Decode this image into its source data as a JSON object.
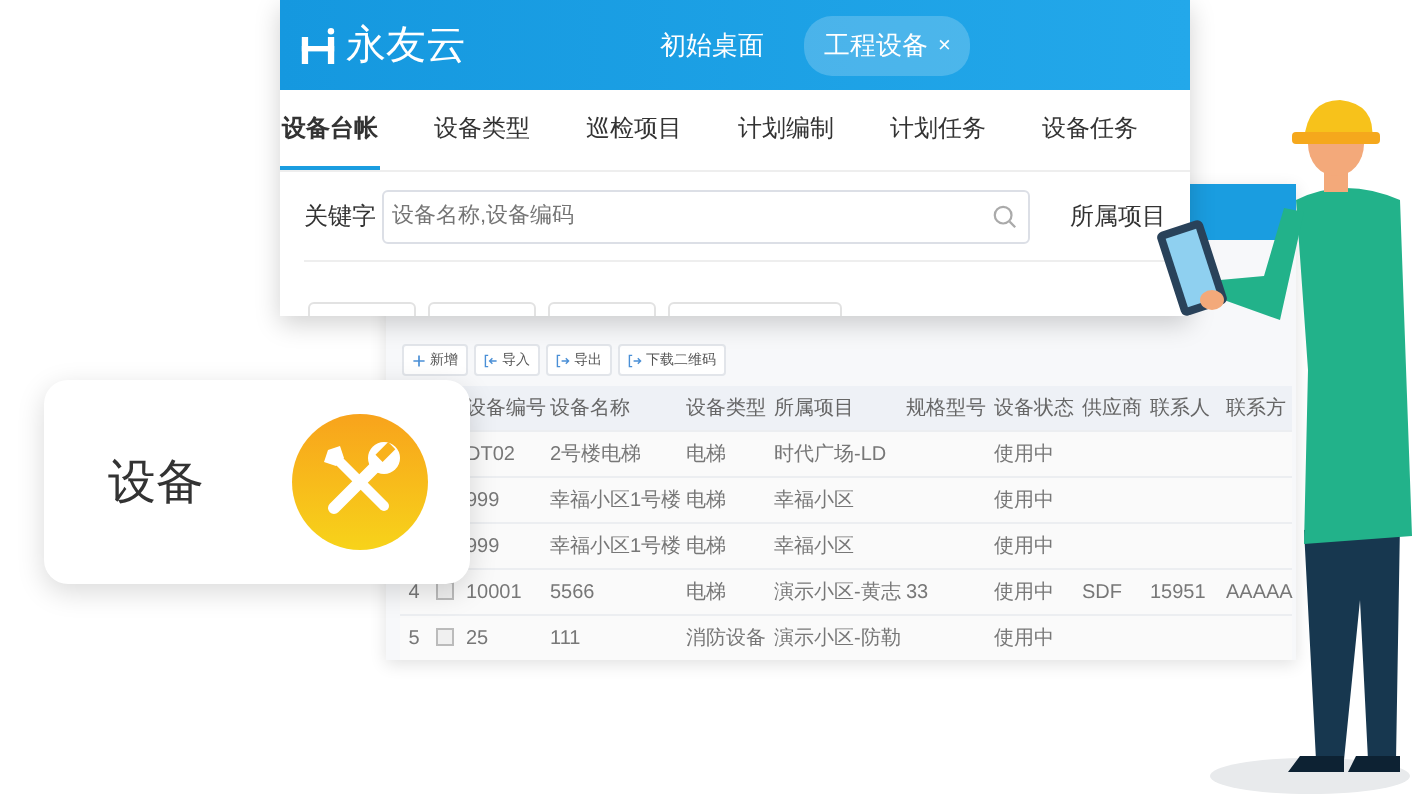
{
  "app_window": {
    "logo": "永友云",
    "open_tabs": [
      {
        "label": "初始桌面",
        "selected": false
      },
      {
        "label": "工程设备",
        "selected": true,
        "close": "×"
      }
    ],
    "nav_tabs": [
      {
        "label": "设备台帐",
        "selected": true
      },
      {
        "label": "设备类型",
        "selected": false
      },
      {
        "label": "巡检项目",
        "selected": false
      },
      {
        "label": "计划编制",
        "selected": false
      },
      {
        "label": "计划任务",
        "selected": false
      },
      {
        "label": "设备任务",
        "selected": false
      }
    ],
    "search": {
      "label": "关键字",
      "placeholder": "设备名称,设备编码",
      "project_label": "所属项目"
    }
  },
  "ledger": {
    "toolbar": [
      {
        "kind": "add",
        "label": "新增"
      },
      {
        "kind": "import",
        "label": "导入"
      },
      {
        "kind": "export",
        "label": "导出"
      },
      {
        "kind": "export",
        "label": "下载二维码"
      }
    ],
    "columns": [
      "设备编号",
      "设备名称",
      "设备类型",
      "所属项目",
      "规格型号",
      "设备状态",
      "供应商",
      "联系人",
      "联系方"
    ],
    "rows": [
      {
        "cells": [
          "DT02",
          "2号楼电梯",
          "电梯",
          "时代广场-LD",
          "",
          "使用中",
          "",
          "",
          ""
        ]
      },
      {
        "cells": [
          "999",
          "幸福小区1号楼",
          "电梯",
          "幸福小区",
          "",
          "使用中",
          "",
          "",
          ""
        ]
      },
      {
        "cells": [
          "999",
          "幸福小区1号楼",
          "电梯",
          "幸福小区",
          "",
          "使用中",
          "",
          "",
          ""
        ]
      },
      {
        "number": "4",
        "checked": false,
        "cells": [
          "10001",
          "5566",
          "电梯",
          "演示小区-黄志",
          "33",
          "使用中",
          "SDF",
          "15951",
          "AAAAA"
        ]
      },
      {
        "number": "5",
        "checked": false,
        "cells": [
          "25",
          "111",
          "消防设备",
          "演示小区-防勒",
          "",
          "使用中",
          "",
          "",
          ""
        ]
      }
    ]
  },
  "feature_card": {
    "label": "设备"
  }
}
